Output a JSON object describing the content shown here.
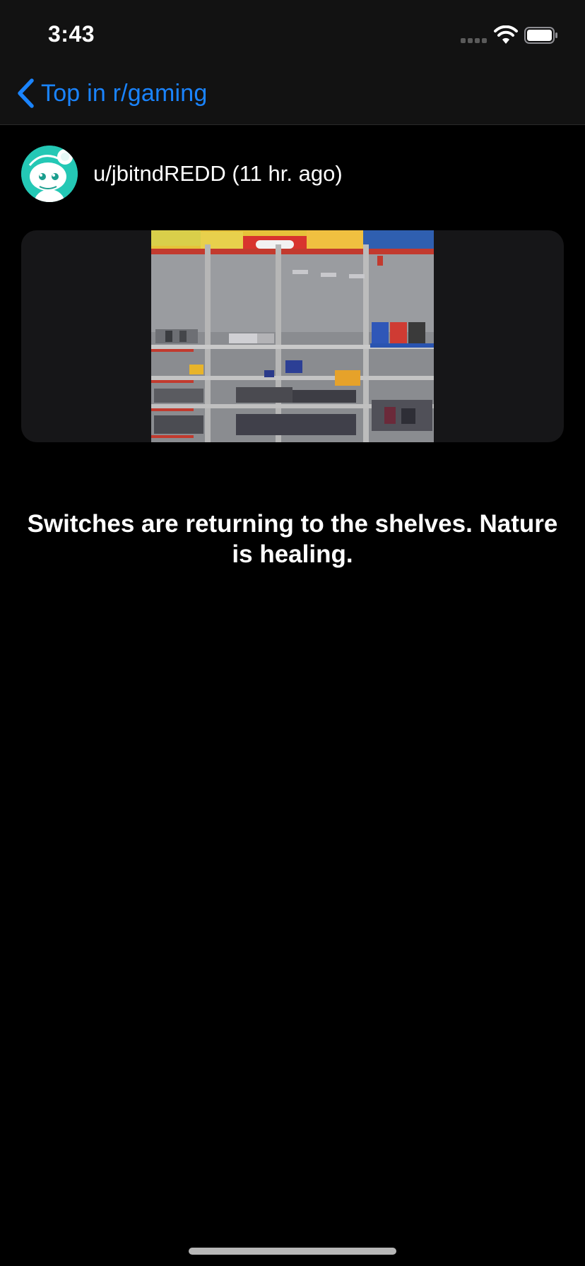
{
  "status_bar": {
    "time": "3:43"
  },
  "nav": {
    "back_label": "Top in r/gaming",
    "accent_color": "#1a84ff"
  },
  "post": {
    "author": "u/jbitndREDD (11 hr. ago)",
    "avatar_icon": "reddit-snoo-avatar",
    "avatar_color": "#24c8b5",
    "image_icon": "store-shelf-photo",
    "title": "Switches are returning to the shelves. Nature is healing."
  }
}
